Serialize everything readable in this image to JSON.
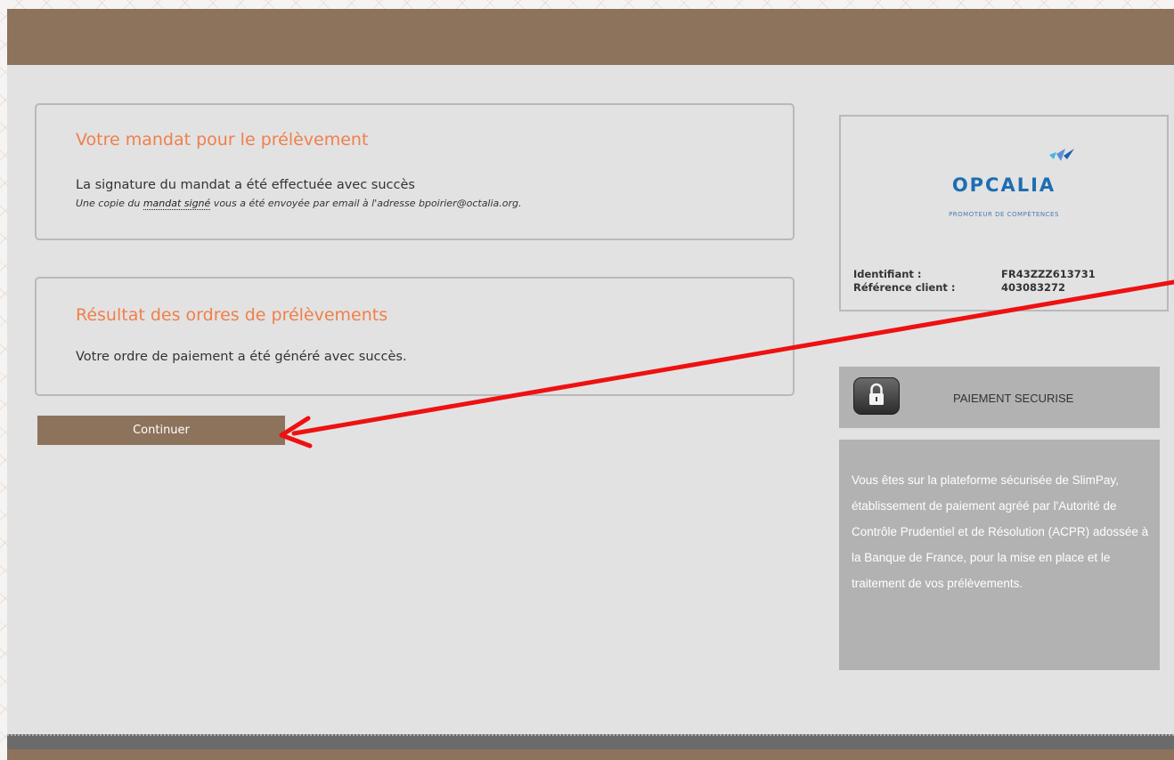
{
  "mandate_panel": {
    "title": "Votre mandat pour le prélèvement",
    "message": "La signature du mandat a été effectuée avec succès",
    "note_before_link": "Une copie du ",
    "note_link": "mandat signé",
    "note_after_link": " vous a été envoyée par email à l'adresse bpoirier@octalia.org."
  },
  "result_panel": {
    "title": "Résultat des ordres de prélèvements",
    "message": "Votre ordre de paiement a été généré avec succès."
  },
  "continue_button": {
    "label": "Continuer"
  },
  "merchant": {
    "logo_text": "OPCALIA",
    "logo_tagline": "PROMOTEUR DE COMPÉTENCES",
    "identifier_label": "Identifiant :",
    "identifier_value": "FR43ZZZ613731",
    "client_ref_label": "Référence client :",
    "client_ref_value": "403083272"
  },
  "secure": {
    "icon": "lock-icon",
    "label": "PAIEMENT SECURISE",
    "description": "Vous êtes sur la plateforme sécurisée de SlimPay, établissement de paiement agréé par l'Autorité de Contrôle Prudentiel et de Résolution (ACPR) adossée à la Banque de France, pour la mise en place et le traitement de vos prélèvements."
  },
  "colors": {
    "brand_brown": "#8d735c",
    "title_orange": "#f07f4b",
    "panel_gray": "#e2e2e2",
    "side_gray": "#b2b2b2",
    "annotation_red": "#ee1111",
    "logo_blue": "#1d6db3"
  }
}
